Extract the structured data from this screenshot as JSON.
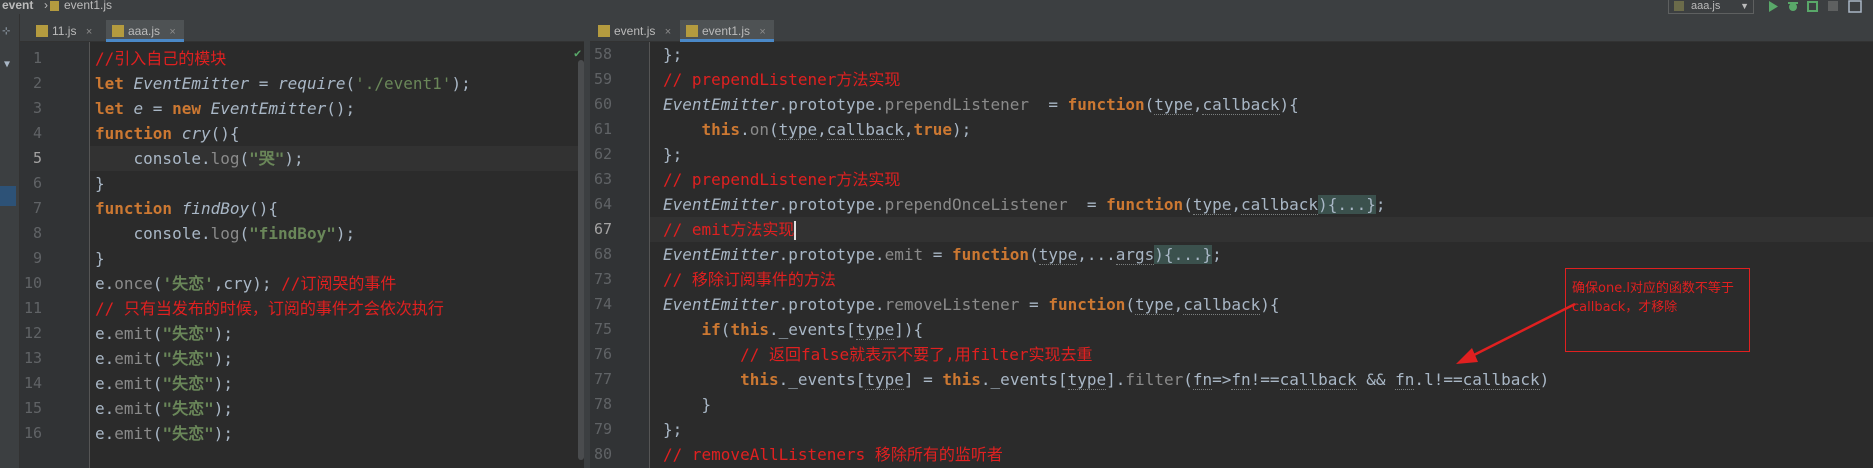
{
  "project": {
    "name": "event",
    "file": "event1.js"
  },
  "run_config": {
    "label": "aaa.js"
  },
  "left_tabs": [
    {
      "label": "11.js",
      "close": "×",
      "active": false
    },
    {
      "label": "aaa.js",
      "close": "×",
      "active": true
    }
  ],
  "right_tabs": [
    {
      "label": "event.js",
      "close": "×",
      "active": false
    },
    {
      "label": "event1.js",
      "close": "×",
      "active": true
    }
  ],
  "left_editor": {
    "line_numbers": [
      "1",
      "2",
      "3",
      "4",
      "5",
      "6",
      "7",
      "8",
      "9",
      "10",
      "11",
      "12",
      "13",
      "14",
      "15",
      "16"
    ],
    "lines": [
      {
        "t1": "//引入自己的模块"
      },
      {
        "t1": "let ",
        "t2": "EventEmitter",
        "t3": " = ",
        "t4": "require",
        "t5": "(",
        "t6": "'./event1'",
        "t7": ");"
      },
      {
        "t1": "let ",
        "t2": "e",
        "t3": " = ",
        "t4": "new ",
        "t5": "EventEmitter",
        "t6": "();"
      },
      {
        "t1": "function ",
        "t2": "cry",
        "t3": "(){"
      },
      {
        "t1": "    console.",
        "t2": "log",
        "t3": "(",
        "t4": "\"哭\"",
        "t5": ");"
      },
      {
        "t1": "}"
      },
      {
        "t1": "function ",
        "t2": "findBoy",
        "t3": "(){"
      },
      {
        "t1": "    console.",
        "t2": "log",
        "t3": "(",
        "t4": "\"findBoy\"",
        "t5": ");"
      },
      {
        "t1": "}"
      },
      {
        "t1": "e.",
        "t2": "once",
        "t3": "(",
        "t4": "'失恋'",
        "t5": ",cry); ",
        "t6": "//订阅哭的事件"
      },
      {
        "t1": "// 只有当发布的时候，订阅的事件才会依次执行"
      },
      {
        "t1": "e.",
        "t2": "emit",
        "t3": "(",
        "t4": "\"失恋\"",
        "t5": ");"
      },
      {
        "t1": "e.",
        "t2": "emit",
        "t3": "(",
        "t4": "\"失恋\"",
        "t5": ");"
      },
      {
        "t1": "e.",
        "t2": "emit",
        "t3": "(",
        "t4": "\"失恋\"",
        "t5": ");"
      },
      {
        "t1": "e.",
        "t2": "emit",
        "t3": "(",
        "t4": "\"失恋\"",
        "t5": ");"
      },
      {
        "t1": "e.",
        "t2": "emit",
        "t3": "(",
        "t4": "\"失恋\"",
        "t5": ");"
      }
    ]
  },
  "right_editor": {
    "line_numbers": [
      "58",
      "59",
      "60",
      "61",
      "62",
      "63",
      "64",
      "67",
      "68",
      "73",
      "74",
      "75",
      "76",
      "77",
      "78",
      "79",
      "80"
    ],
    "lines": [
      {
        "t1": "};"
      },
      {
        "t1": "// prependListener方法实现"
      },
      {
        "t1": "EventEmitter",
        "t2": ".prototype.",
        "t3": "prependListener",
        "t4": "  = ",
        "t5": "function",
        "t6": "(",
        "t7": "type",
        "t8": ",",
        "t9": "callback",
        "t10": "){"
      },
      {
        "t1": "    ",
        "t2": "this",
        "t3": ".",
        "t4": "on",
        "t5": "(",
        "t6": "type",
        "t7": ",",
        "t8": "callback",
        "t9": ",",
        "t10": "true",
        "t11": ");"
      },
      {
        "t1": "};"
      },
      {
        "t1": "// prependListener方法实现"
      },
      {
        "t1": "EventEmitter",
        "t2": ".prototype.",
        "t3": "prependOnceListener",
        "t4": "  = ",
        "t5": "function",
        "t6": "(",
        "t7": "type",
        "t8": ",",
        "t9": "callback",
        "t10": "){...}",
        "t11": ";"
      },
      {
        "t1": "// emit方法实现"
      },
      {
        "t1": "EventEmitter",
        "t2": ".prototype.",
        "t3": "emit",
        "t4": " = ",
        "t5": "function",
        "t6": "(",
        "t7": "type",
        "t8": ",...",
        "t9": "args",
        "t10": "){...}",
        "t11": ";"
      },
      {
        "t1": "// 移除订阅事件的方法"
      },
      {
        "t1": "EventEmitter",
        "t2": ".prototype.",
        "t3": "removeListener",
        "t4": " = ",
        "t5": "function",
        "t6": "(",
        "t7": "type",
        "t8": ",",
        "t9": "callback",
        "t10": "){"
      },
      {
        "t1": "    ",
        "t2": "if",
        "t3": "(",
        "t4": "this",
        "t5": ".",
        "t6": "_events",
        "t7": "[",
        "t8": "type",
        "t9": "]){"
      },
      {
        "t1": "        // 返回false就表示不要了,用filter实现去重"
      },
      {
        "t1": "        ",
        "t2": "this",
        "t3": ".",
        "t4": "_events",
        "t5": "[",
        "t6": "type",
        "t7": "] = ",
        "t8": "this",
        "t9": ".",
        "t10": "_events",
        "t11": "[",
        "t12": "type",
        "t13": "].",
        "t14": "filter",
        "t15": "(",
        "t16": "fn",
        "t17": "=>",
        "t18": "fn",
        "t19": "!==",
        "t20": "callback",
        "t21": " && ",
        "t22": "fn",
        "t23": ".",
        "t24": "l",
        "t25": "!==",
        "t26": "callback",
        "t27": ")"
      },
      {
        "t1": "    }"
      },
      {
        "t1": "};"
      },
      {
        "t1": "// removeAllListeners 移除所有的监听者"
      }
    ]
  },
  "annotation": {
    "text": "确保one.l对应的函数不等于callback，才移除"
  },
  "colors": {
    "accent": "#e02020",
    "keyword": "#cc7832",
    "string": "#6a8759",
    "comment": "#808080",
    "function": "#ffc66d",
    "property": "#9876aa"
  }
}
